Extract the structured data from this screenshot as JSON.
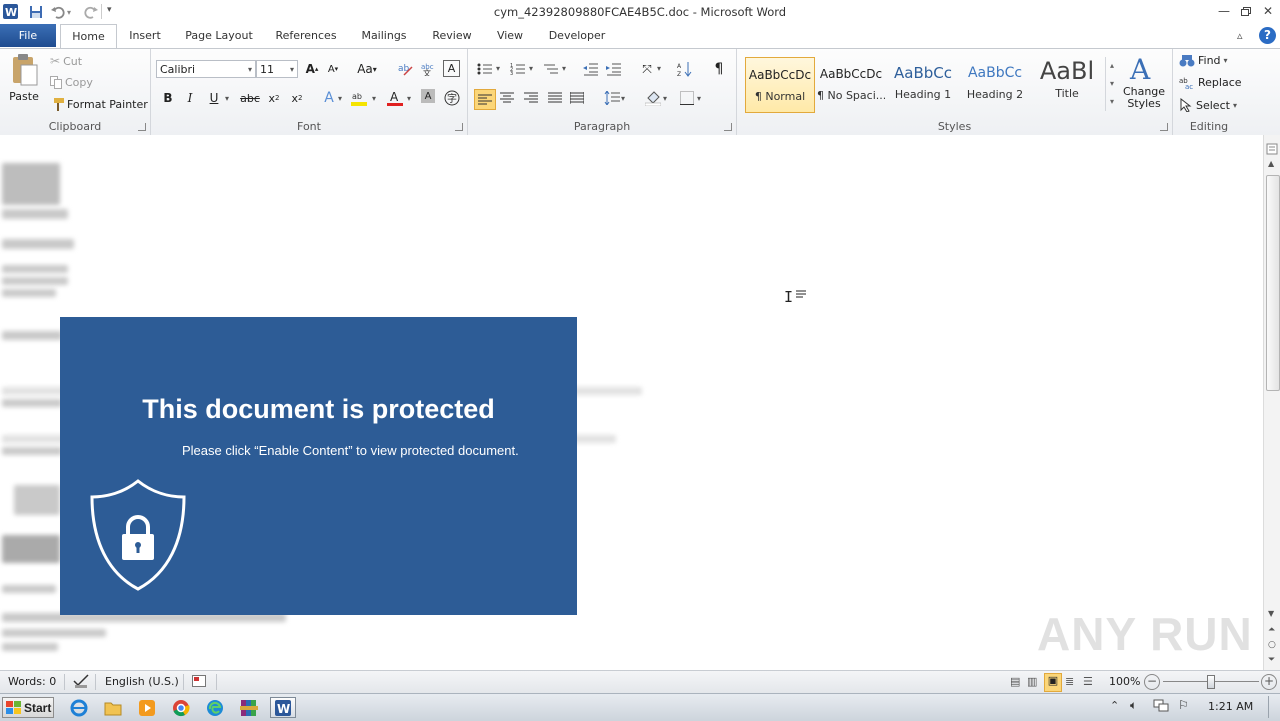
{
  "window": {
    "title": "cym_42392809880FCAE4B5C.doc - Microsoft Word"
  },
  "tabs": [
    "File",
    "Home",
    "Insert",
    "Page Layout",
    "References",
    "Mailings",
    "Review",
    "View",
    "Developer"
  ],
  "clipboard": {
    "paste": "Paste",
    "cut": "Cut",
    "copy": "Copy",
    "format_painter": "Format Painter",
    "label": "Clipboard"
  },
  "font": {
    "name": "Calibri",
    "size": "11",
    "label": "Font"
  },
  "paragraph": {
    "label": "Paragraph"
  },
  "styles": {
    "items": [
      {
        "sample": "AaBbCcDc",
        "name": "¶ Normal",
        "color": "#222222"
      },
      {
        "sample": "AaBbCcDc",
        "name": "¶ No Spaci...",
        "color": "#222222"
      },
      {
        "sample": "AaBbCc",
        "name": "Heading 1",
        "color": "#2e5f9b"
      },
      {
        "sample": "AaBbCc",
        "name": "Heading 2",
        "color": "#3f78c0"
      },
      {
        "sample": "AaBl",
        "name": "Title",
        "color": "#444444"
      }
    ],
    "change": "Change Styles",
    "label": "Styles"
  },
  "editing": {
    "find": "Find",
    "replace": "Replace",
    "select": "Select",
    "label": "Editing"
  },
  "banner": {
    "headline": "This document is protected",
    "subtext": "Please click “Enable Content” to view protected document."
  },
  "status": {
    "words": "Words: 0",
    "language": "English (U.S.)",
    "zoom": "100%",
    "zoom_level": 0.5
  },
  "taskbar": {
    "start": "Start",
    "clock": "1:21 AM"
  },
  "watermark": "ANY RUN",
  "colors": {
    "file_tab": "#2b579a",
    "banner_bg": "#2d5c96",
    "accent": "#f6c94a"
  }
}
